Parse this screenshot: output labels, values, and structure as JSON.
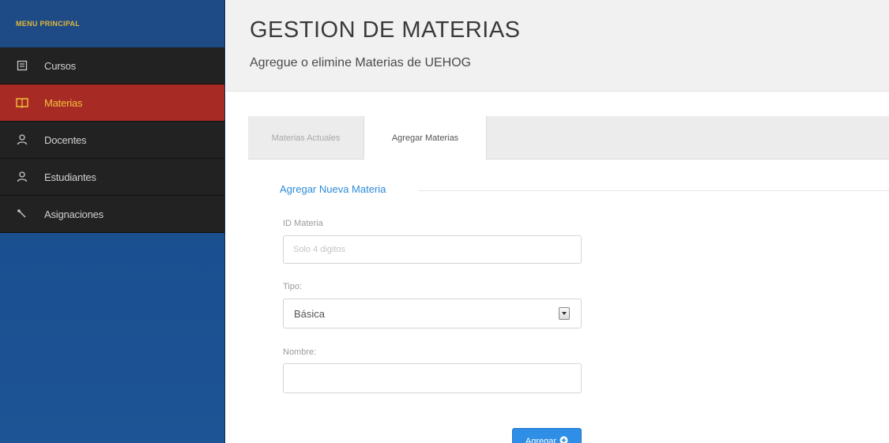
{
  "sidebar": {
    "header": "MENU PRINCIPAL",
    "items": [
      {
        "label": "Cursos",
        "icon": "list-icon"
      },
      {
        "label": "Materias",
        "icon": "book-icon",
        "active": true
      },
      {
        "label": "Docentes",
        "icon": "user-icon"
      },
      {
        "label": "Estudiantes",
        "icon": "user-icon"
      },
      {
        "label": "Asignaciones",
        "icon": "wrench-icon"
      }
    ]
  },
  "header": {
    "title": "GESTION DE MATERIAS",
    "subtitle": "Agregue o elimine Materias de UEHOG"
  },
  "tabs": [
    {
      "label": "Materias Actuales",
      "active": false
    },
    {
      "label": "Agregar Materias",
      "active": true
    }
  ],
  "form": {
    "legend": "Agregar Nueva Materia",
    "id_label": "ID Materia",
    "id_placeholder": "Solo 4 digitos",
    "id_value": "",
    "tipo_label": "Tipo:",
    "tipo_value": "Básica",
    "nombre_label": "Nombre:",
    "nombre_value": "",
    "submit_label": "Agregar"
  },
  "colors": {
    "accent": "#2f8fe6",
    "active_menu": "#a82a25",
    "active_menu_text": "#f0c23a",
    "sidebar_bg": "#1d4f8c"
  }
}
